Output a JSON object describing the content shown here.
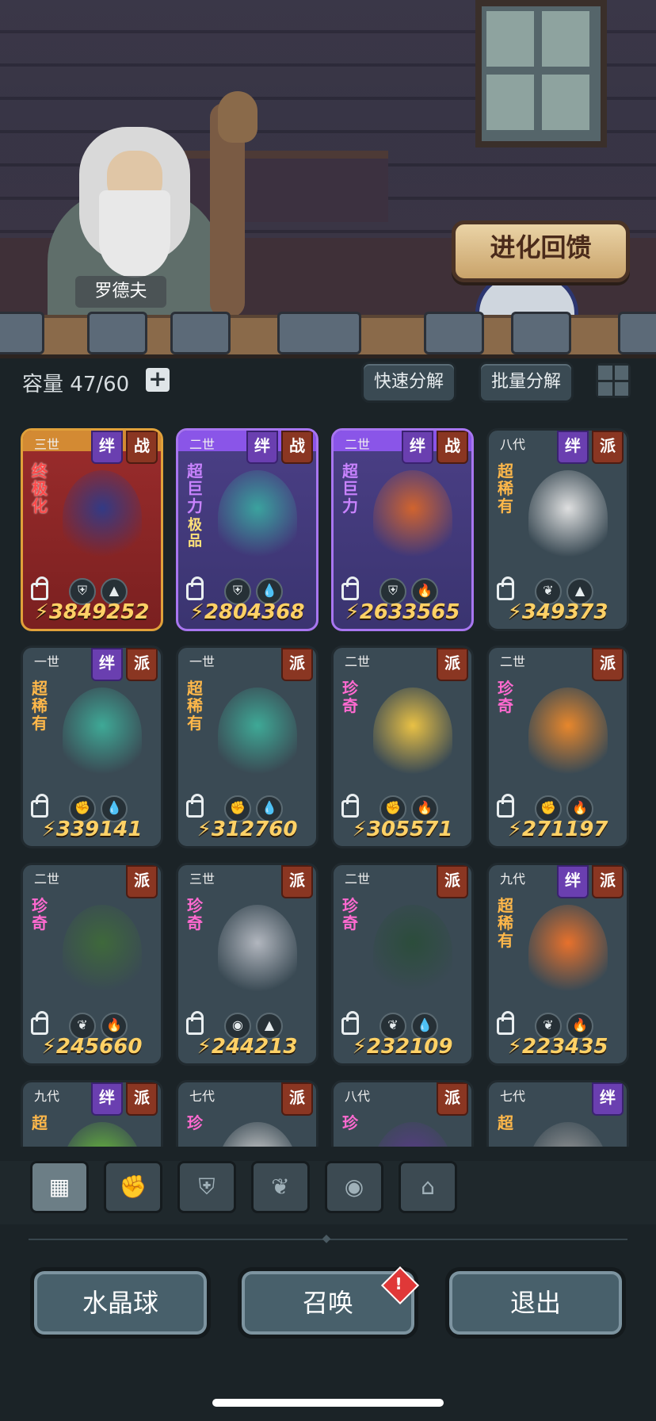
{
  "scene": {
    "character_name": "罗德夫",
    "evolution_button": "进化回馈"
  },
  "capacity": {
    "label": "容量",
    "value": "47/60",
    "plus": "+"
  },
  "toolbar": {
    "quick_decompose": "快速分解",
    "batch_decompose": "批量分解"
  },
  "cards": [
    {
      "gen": "三世",
      "style": "red",
      "badges": [
        "绊",
        "战"
      ],
      "rarity": "终极化",
      "rarity_class": "ultimate",
      "elements": [
        "shield-icon",
        "earth-icon"
      ],
      "power": "3849252"
    },
    {
      "gen": "二世",
      "style": "purple",
      "badges": [
        "绊",
        "战"
      ],
      "rarity": "超巨力",
      "rarity_class": "superpower",
      "sub_tag": "极品",
      "elements": [
        "shield-icon",
        "water-icon"
      ],
      "power": "2804368"
    },
    {
      "gen": "二世",
      "style": "purple",
      "badges": [
        "绊",
        "战"
      ],
      "rarity": "超巨力",
      "rarity_class": "superpower",
      "elements": [
        "shield-icon",
        "fire-icon"
      ],
      "power": "2633565"
    },
    {
      "gen": "八代",
      "style": "blue",
      "badges": [
        "绊",
        "派"
      ],
      "rarity": "超稀有",
      "rarity_class": "super-rare",
      "elements": [
        "sprout-icon",
        "earth-icon"
      ],
      "power": "349373"
    },
    {
      "gen": "一世",
      "style": "blue",
      "badges": [
        "绊",
        "派"
      ],
      "rarity": "超稀有",
      "rarity_class": "super-rare",
      "elements": [
        "fist-icon",
        "water-icon"
      ],
      "power": "339141"
    },
    {
      "gen": "一世",
      "style": "blue",
      "badges": [
        "派"
      ],
      "rarity": "超稀有",
      "rarity_class": "super-rare",
      "elements": [
        "fist-icon",
        "water-icon"
      ],
      "power": "312760"
    },
    {
      "gen": "二世",
      "style": "blue",
      "badges": [
        "派"
      ],
      "rarity": "珍奇",
      "rarity_class": "rare",
      "elements": [
        "fist-icon",
        "fire-icon"
      ],
      "power": "305571"
    },
    {
      "gen": "二世",
      "style": "blue",
      "badges": [
        "派"
      ],
      "rarity": "珍奇",
      "rarity_class": "rare",
      "elements": [
        "fist-icon",
        "fire-icon"
      ],
      "power": "271197"
    },
    {
      "gen": "二世",
      "style": "blue",
      "badges": [
        "派"
      ],
      "rarity": "珍奇",
      "rarity_class": "rare",
      "elements": [
        "sprout-icon",
        "fire-icon"
      ],
      "power": "245660"
    },
    {
      "gen": "三世",
      "style": "blue",
      "badges": [
        "派"
      ],
      "rarity": "珍奇",
      "rarity_class": "rare",
      "elements": [
        "alien-icon",
        "earth-icon"
      ],
      "power": "244213"
    },
    {
      "gen": "二世",
      "style": "blue",
      "badges": [
        "派"
      ],
      "rarity": "珍奇",
      "rarity_class": "rare",
      "elements": [
        "sprout-icon",
        "water-icon"
      ],
      "power": "232109"
    },
    {
      "gen": "九代",
      "style": "blue",
      "badges": [
        "绊",
        "派"
      ],
      "rarity": "超稀有",
      "rarity_class": "super-rare",
      "elements": [
        "sprout-icon",
        "fire-icon"
      ],
      "power": "223435"
    },
    {
      "gen": "九代",
      "style": "blue",
      "badges": [
        "绊",
        "派"
      ],
      "rarity": "超",
      "rarity_class": "super-rare",
      "elements": [],
      "power": ""
    },
    {
      "gen": "七代",
      "style": "blue",
      "badges": [
        "派"
      ],
      "rarity": "珍",
      "rarity_class": "rare",
      "elements": [],
      "power": ""
    },
    {
      "gen": "八代",
      "style": "blue",
      "badges": [
        "派"
      ],
      "rarity": "珍",
      "rarity_class": "rare",
      "elements": [],
      "power": ""
    },
    {
      "gen": "七代",
      "style": "blue",
      "badges": [
        "绊"
      ],
      "rarity": "超",
      "rarity_class": "super-rare",
      "elements": [],
      "power": ""
    }
  ],
  "tabs": [
    {
      "name": "tab-all",
      "icon": "blocks-icon",
      "active": true
    },
    {
      "name": "tab-fist",
      "icon": "fist-icon",
      "active": false
    },
    {
      "name": "tab-shield",
      "icon": "winged-shield-icon",
      "active": false
    },
    {
      "name": "tab-sprout",
      "icon": "sprout-icon",
      "active": false
    },
    {
      "name": "tab-alien",
      "icon": "alien-icon",
      "active": false
    },
    {
      "name": "tab-temple",
      "icon": "temple-icon",
      "active": false
    }
  ],
  "bottom_buttons": {
    "crystal_ball": "水晶球",
    "summon": "召唤",
    "summon_alert": "!",
    "exit": "退出"
  },
  "colors": {
    "background": "#1b2327",
    "power_text": "#ffd166",
    "bond_badge": "#6a3fb0",
    "faction_badge": "#8a3622"
  }
}
